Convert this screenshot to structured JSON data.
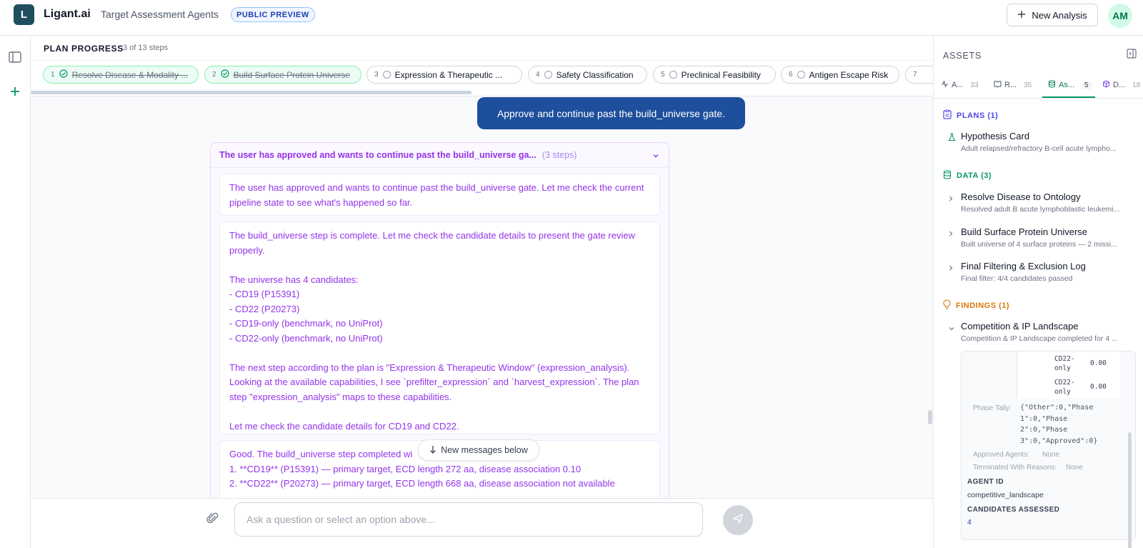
{
  "header": {
    "logo_letter": "L",
    "brand": "Ligant.ai",
    "subtitle": "Target Assessment Agents",
    "badge": "PUBLIC PREVIEW",
    "new_analysis": "New Analysis",
    "avatar": "AM"
  },
  "plan": {
    "title": "PLAN PROGRESS",
    "count": "3 of 13 steps",
    "steps": [
      {
        "num": "1",
        "label": "Resolve Disease & Modality ...",
        "done": true
      },
      {
        "num": "2",
        "label": "Build Surface Protein Universe",
        "done": true
      },
      {
        "num": "3",
        "label": "Expression & Therapeutic ...",
        "done": false
      },
      {
        "num": "4",
        "label": "Safety Classification",
        "done": false
      },
      {
        "num": "5",
        "label": "Preclinical Feasibility",
        "done": false
      },
      {
        "num": "6",
        "label": "Antigen Escape Risk",
        "done": false
      },
      {
        "num": "7",
        "label": "",
        "done": false
      }
    ]
  },
  "chat": {
    "user_message": "Approve and continue past the build_universe gate.",
    "thought_title": "The user has approved and wants to continue past the build_universe ga...",
    "thought_steps": "(3 steps)",
    "step1": "The user has approved and wants to continue past the build_universe gate. Let me check the current pipeline state to see what's happened so far.",
    "step2": "The build_universe step is complete. Let me check the candidate details to present the gate review properly.\n\nThe universe has 4 candidates:\n- CD19 (P15391)\n- CD22 (P20273)\n- CD19-only (benchmark, no UniProt)\n- CD22-only (benchmark, no UniProt)\n\nThe next step according to the plan is \"Expression & Therapeutic Window\" (expression_analysis). Looking at the available capabilities, I see `prefilter_expression` and `harvest_expression`. The plan step \"expression_analysis\" maps to these capabilities.\n\nLet me check the candidate details for CD19 and CD22.",
    "step3": "Good. The build_universe step completed wi\n1. **CD19** (P15391) — primary target, ECD length 272 aa, disease association 0.10\n2. **CD22** (P20273) — primary target, ECD length 668 aa, disease association not available",
    "new_messages": "New messages below",
    "input_placeholder": "Ask a question or select an option above..."
  },
  "assets": {
    "title": "ASSETS",
    "tabs": [
      {
        "label": "A...",
        "count": "33",
        "icon": "activity-icon"
      },
      {
        "label": "R...",
        "count": "35",
        "icon": "book-icon"
      },
      {
        "label": "As...",
        "count": "5",
        "icon": "database-icon",
        "active": true
      },
      {
        "label": "D...",
        "count": "18",
        "icon": "cube-icon"
      }
    ],
    "plans_header": "PLANS (1)",
    "plan_item_title": "Hypothesis Card",
    "plan_item_sub": "Adult relapsed/refractory B-cell acute lympho...",
    "data_header": "DATA (3)",
    "data_items": [
      {
        "title": "Resolve Disease to Ontology",
        "sub": "Resolved adult B acute lymphoblastic leukemi..."
      },
      {
        "title": "Build Surface Protein Universe",
        "sub": "Built universe of 4 surface proteins — 2 missi..."
      },
      {
        "title": "Final Filtering & Exclusion Log",
        "sub": "Final filter: 4/4 candidates passed"
      }
    ],
    "findings_header": "FINDINGS (1)",
    "finding_title": "Competition & IP Landscape",
    "finding_sub": "Competition & IP Landscape completed for 4 ...",
    "mini_rows": [
      {
        "name": "CD22-\nonly",
        "value": "0.00"
      },
      {
        "name": "CD22-\nonly",
        "value": "0.00"
      }
    ],
    "phase_tally_label": "Phase Tally:",
    "phase_tally_value": "{\"Other\":0,\"Phase\n1\":0,\"Phase\n2\":0,\"Phase\n3\":0,\"Approved\":0}",
    "approved_label": "Approved Agents:",
    "approved_value": "None",
    "terminated_label": "Terminated With Reasons:",
    "terminated_value": "None",
    "agent_id_label": "AGENT ID",
    "agent_id_value": "competitive_landscape",
    "candidates_label": "CANDIDATES ASSESSED",
    "candidates_value": "4"
  },
  "colors": {
    "accent": "#1e4f9c",
    "thought": "#9333ea",
    "success": "#059669"
  }
}
